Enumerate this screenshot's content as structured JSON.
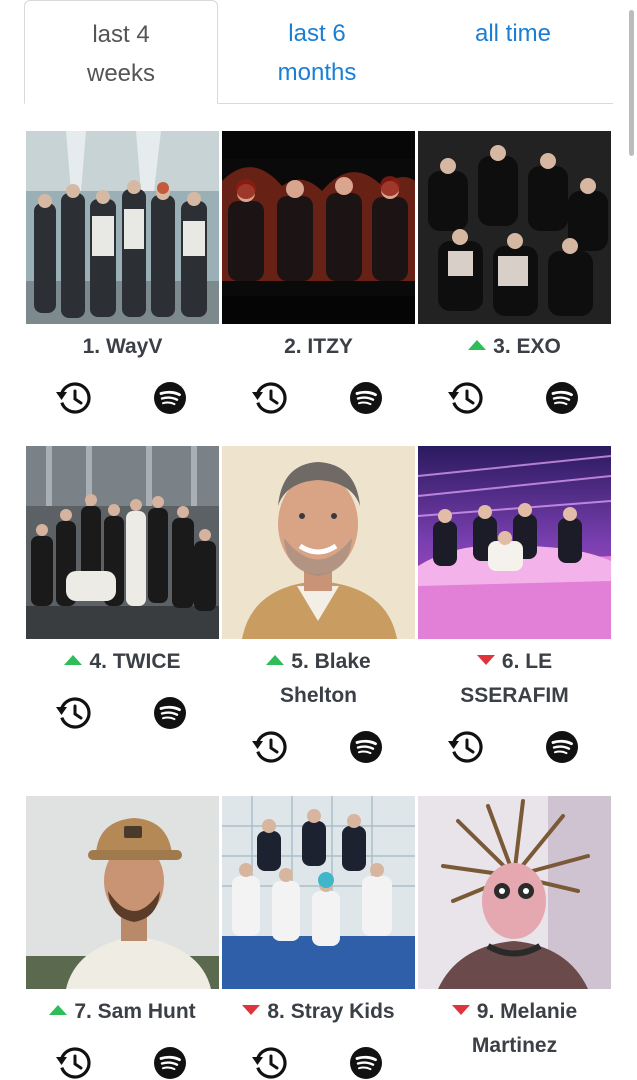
{
  "tabs": [
    {
      "label": "last 4 weeks",
      "line1": "last 4",
      "line2": "weeks",
      "active": true
    },
    {
      "label": "last 6 months",
      "line1": "last 6",
      "line2": "months",
      "active": false
    },
    {
      "label": "all time",
      "line1": "all time",
      "line2": "",
      "active": false
    }
  ],
  "colors": {
    "link_blue": "#1a7fd4",
    "text_dark": "#3b3f46",
    "rank_up": "#2ebd59",
    "rank_down": "#e0343c"
  },
  "artists": [
    {
      "rank": 1,
      "label": "1. WayV",
      "line1": "1. WayV",
      "line2": "",
      "trend": "none"
    },
    {
      "rank": 2,
      "label": "2. ITZY",
      "line1": "2. ITZY",
      "line2": "",
      "trend": "none"
    },
    {
      "rank": 3,
      "label": "3. EXO",
      "line1": "3. EXO",
      "line2": "",
      "trend": "up"
    },
    {
      "rank": 4,
      "label": "4. TWICE",
      "line1": "4. TWICE",
      "line2": "",
      "trend": "up"
    },
    {
      "rank": 5,
      "label": "5. Blake Shelton",
      "line1": "5. Blake",
      "line2": "Shelton",
      "trend": "up"
    },
    {
      "rank": 6,
      "label": "6. LE SSERAFIM",
      "line1": "6. LE",
      "line2": "SSERAFIM",
      "trend": "down"
    },
    {
      "rank": 7,
      "label": "7. Sam Hunt",
      "line1": "7. Sam Hunt",
      "line2": "",
      "trend": "up"
    },
    {
      "rank": 8,
      "label": "8. Stray Kids",
      "line1": "8. Stray Kids",
      "line2": "",
      "trend": "down"
    },
    {
      "rank": 9,
      "label": "9. Melanie Martinez",
      "line1": "9. Melanie",
      "line2": "Martinez",
      "trend": "down"
    }
  ],
  "icons": {
    "history": "history-icon",
    "spotify": "spotify-icon"
  }
}
